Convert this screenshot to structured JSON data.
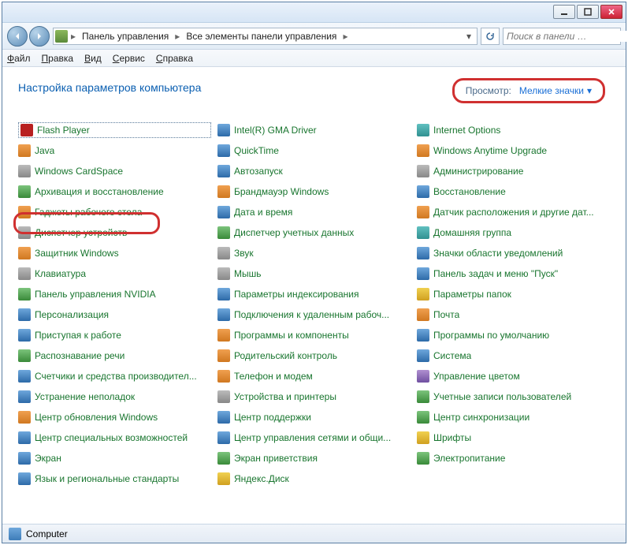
{
  "titlebar": {},
  "nav": {
    "crumbs": [
      "Панель управления",
      "Все элементы панели управления"
    ],
    "search_placeholder": "Поиск в панели …"
  },
  "menu": [
    "Файл",
    "Правка",
    "Вид",
    "Сервис",
    "Справка"
  ],
  "heading": "Настройка параметров компьютера",
  "view": {
    "label": "Просмотр:",
    "value": "Мелкие значки"
  },
  "items": [
    {
      "name": "Flash Player",
      "ic": "c-red"
    },
    {
      "name": "Intel(R) GMA Driver",
      "ic": "c-blue"
    },
    {
      "name": "Internet Options",
      "ic": "c-teal"
    },
    {
      "name": "Java",
      "ic": "c-orange"
    },
    {
      "name": "QuickTime",
      "ic": "c-blue"
    },
    {
      "name": "Windows Anytime Upgrade",
      "ic": "c-orange"
    },
    {
      "name": "Windows CardSpace",
      "ic": "c-gray"
    },
    {
      "name": "Автозапуск",
      "ic": "c-blue"
    },
    {
      "name": "Администрирование",
      "ic": "c-gray"
    },
    {
      "name": "Архивация и восстановление",
      "ic": "c-green"
    },
    {
      "name": "Брандмауэр Windows",
      "ic": "c-orange"
    },
    {
      "name": "Восстановление",
      "ic": "c-blue"
    },
    {
      "name": "Гаджеты рабочего стола",
      "ic": "c-orange"
    },
    {
      "name": "Дата и время",
      "ic": "c-blue"
    },
    {
      "name": "Датчик расположения и другие дат...",
      "ic": "c-orange"
    },
    {
      "name": "Диспетчер устройств",
      "ic": "c-gray"
    },
    {
      "name": "Диспетчер учетных данных",
      "ic": "c-green"
    },
    {
      "name": "Домашняя группа",
      "ic": "c-teal"
    },
    {
      "name": "Защитник Windows",
      "ic": "c-orange"
    },
    {
      "name": "Звук",
      "ic": "c-gray"
    },
    {
      "name": "Значки области уведомлений",
      "ic": "c-blue"
    },
    {
      "name": "Клавиатура",
      "ic": "c-gray"
    },
    {
      "name": "Мышь",
      "ic": "c-gray"
    },
    {
      "name": "Панель задач и меню \"Пуск\"",
      "ic": "c-blue"
    },
    {
      "name": "Панель управления NVIDIA",
      "ic": "c-green"
    },
    {
      "name": "Параметры индексирования",
      "ic": "c-blue"
    },
    {
      "name": "Параметры папок",
      "ic": "c-yellow"
    },
    {
      "name": "Персонализация",
      "ic": "c-blue"
    },
    {
      "name": "Подключения к удаленным рабоч...",
      "ic": "c-blue"
    },
    {
      "name": "Почта",
      "ic": "c-orange"
    },
    {
      "name": "Приступая к работе",
      "ic": "c-blue"
    },
    {
      "name": "Программы и компоненты",
      "ic": "c-orange"
    },
    {
      "name": "Программы по умолчанию",
      "ic": "c-blue"
    },
    {
      "name": "Распознавание речи",
      "ic": "c-green"
    },
    {
      "name": "Родительский контроль",
      "ic": "c-orange"
    },
    {
      "name": "Система",
      "ic": "c-blue"
    },
    {
      "name": "Счетчики и средства производител...",
      "ic": "c-blue"
    },
    {
      "name": "Телефон и модем",
      "ic": "c-orange"
    },
    {
      "name": "Управление цветом",
      "ic": "c-purple"
    },
    {
      "name": "Устранение неполадок",
      "ic": "c-blue"
    },
    {
      "name": "Устройства и принтеры",
      "ic": "c-gray"
    },
    {
      "name": "Учетные записи пользователей",
      "ic": "c-green"
    },
    {
      "name": "Центр обновления Windows",
      "ic": "c-orange"
    },
    {
      "name": "Центр поддержки",
      "ic": "c-blue"
    },
    {
      "name": "Центр синхронизации",
      "ic": "c-green"
    },
    {
      "name": "Центр специальных возможностей",
      "ic": "c-blue"
    },
    {
      "name": "Центр управления сетями и общи...",
      "ic": "c-blue"
    },
    {
      "name": "Шрифты",
      "ic": "c-yellow"
    },
    {
      "name": "Экран",
      "ic": "c-blue"
    },
    {
      "name": "Экран приветствия",
      "ic": "c-green"
    },
    {
      "name": "Электропитание",
      "ic": "c-green"
    },
    {
      "name": "Язык и региональные стандарты",
      "ic": "c-blue"
    },
    {
      "name": "Яндекс.Диск",
      "ic": "c-yellow"
    }
  ],
  "status": "Computer"
}
